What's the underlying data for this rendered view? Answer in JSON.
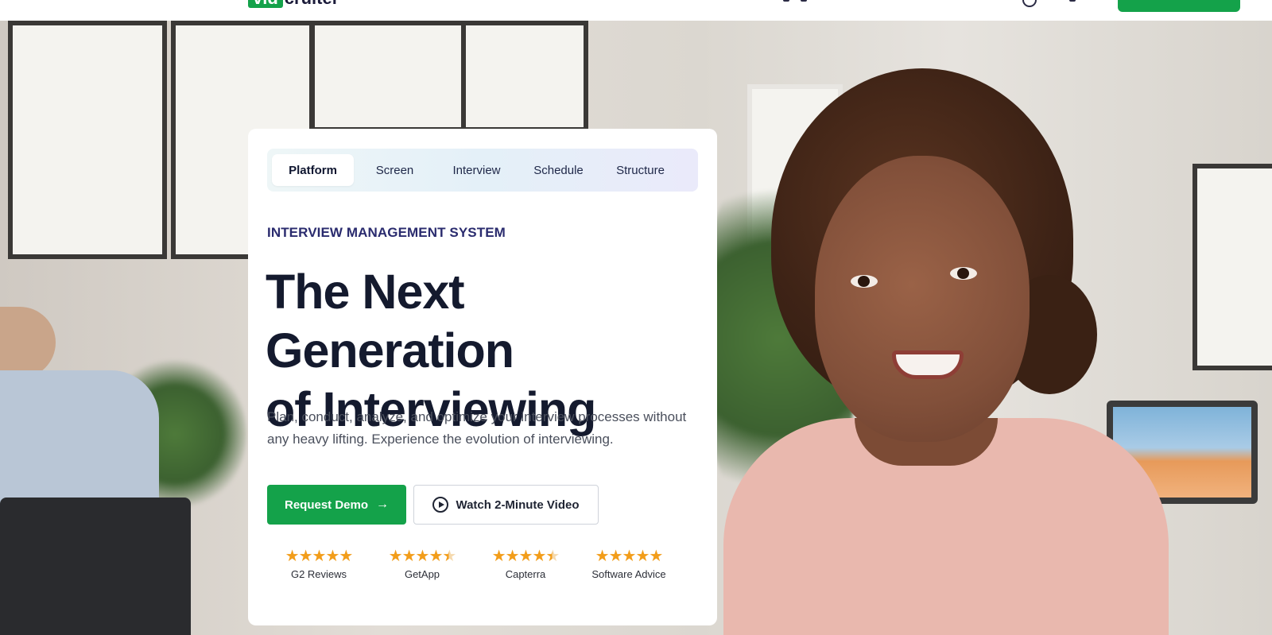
{
  "brand": {
    "logo_box": "vid",
    "logo_rest": "cruiter",
    "accent": "#14a24a"
  },
  "hero": {
    "tabs": [
      {
        "label": "Platform",
        "active": true
      },
      {
        "label": "Screen",
        "active": false
      },
      {
        "label": "Interview",
        "active": false
      },
      {
        "label": "Schedule",
        "active": false
      },
      {
        "label": "Structure",
        "active": false
      }
    ],
    "eyebrow": "INTERVIEW MANAGEMENT SYSTEM",
    "headline_line1": "The Next Generation",
    "headline_line2": "of Interviewing",
    "description": "Plan, conduct, analyze, and optimize your interview processes without any heavy lifting. Experience the evolution of interviewing.",
    "primary_button": {
      "label": "Request Demo",
      "icon": "arrow-right-icon"
    },
    "secondary_button": {
      "label": "Watch 2-Minute Video",
      "icon": "play-circle-icon"
    },
    "ratings": [
      {
        "source": "G2 Reviews",
        "stars": 5
      },
      {
        "source": "GetApp",
        "stars": 4.5
      },
      {
        "source": "Capterra",
        "stars": 4.5
      },
      {
        "source": "Software Advice",
        "stars": 5
      }
    ],
    "star_color": "#f29d1a"
  }
}
